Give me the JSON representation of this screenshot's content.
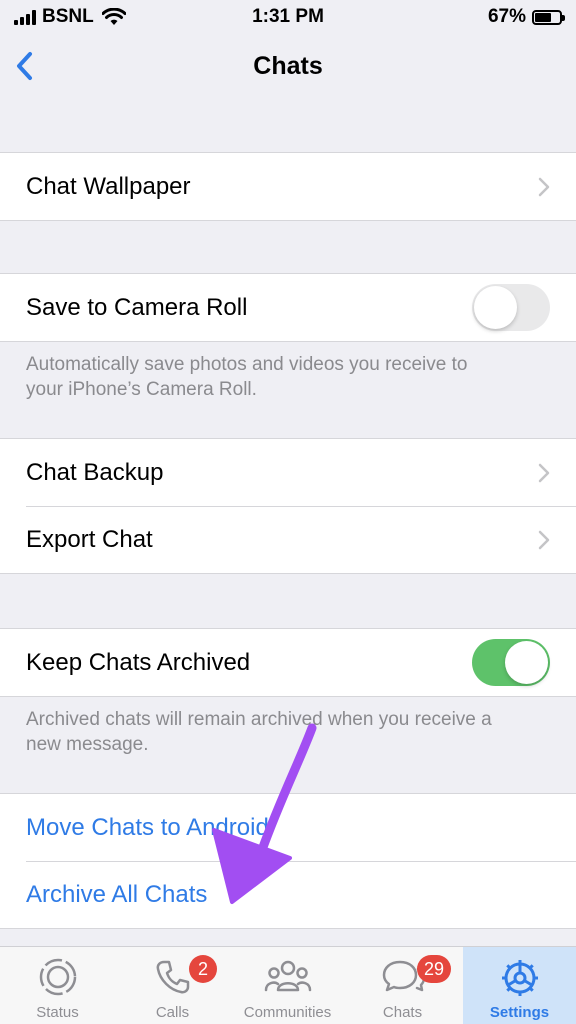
{
  "status_bar": {
    "carrier": "BSNL",
    "time": "1:31 PM",
    "battery_percent": "67%",
    "battery_level": 0.67
  },
  "nav": {
    "title": "Chats"
  },
  "sections": {
    "wallpaper": {
      "label": "Chat Wallpaper"
    },
    "camera_roll": {
      "label": "Save to Camera Roll",
      "enabled": false,
      "note_line1": "Automatically save photos and videos you receive to",
      "note_line2": "your iPhone’s Camera Roll."
    },
    "backup": {
      "label": "Chat Backup"
    },
    "export": {
      "label": "Export Chat"
    },
    "archived": {
      "label": "Keep Chats Archived",
      "enabled": true,
      "note_line1": "Archived chats will remain archived when you receive a",
      "note_line2": "new message."
    },
    "move_android": {
      "label": "Move Chats to Android"
    },
    "archive_all": {
      "label": "Archive All Chats"
    }
  },
  "tab_bar": {
    "tabs": [
      {
        "label": "Status",
        "icon": "status-icon"
      },
      {
        "label": "Calls",
        "icon": "phone-icon",
        "badge": "2"
      },
      {
        "label": "Communities",
        "icon": "communities-icon"
      },
      {
        "label": "Chats",
        "icon": "chat-bubbles-icon",
        "badge": "29"
      },
      {
        "label": "Settings",
        "icon": "gear-icon",
        "active": true
      }
    ]
  },
  "colors": {
    "accent_blue": "#2f7be6",
    "toggle_on": "#5ec26a",
    "badge_red": "#e5463d",
    "annotation_arrow": "#a24ef2"
  }
}
